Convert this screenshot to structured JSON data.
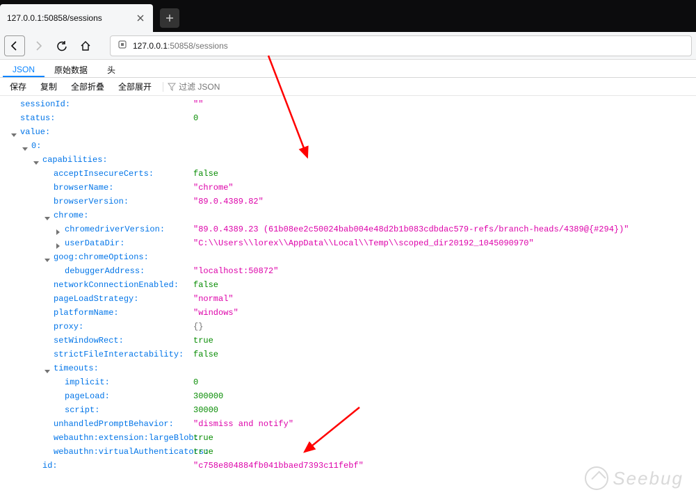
{
  "tab_title": "127.0.0.1:50858/sessions",
  "url": {
    "host": "127.0.0.1",
    "port": ":50858",
    "path": "/sessions"
  },
  "viewtabs": {
    "json": "JSON",
    "raw": "原始数据",
    "headers": "头"
  },
  "toolbar": {
    "save": "保存",
    "copy": "复制",
    "collapse": "全部折叠",
    "expand": "全部展开",
    "filter_placeholder": "过滤 JSON"
  },
  "json_rows": [
    {
      "indent": 0,
      "tw": "",
      "key": "sessionId",
      "vt": "str",
      "val": "\"\""
    },
    {
      "indent": 0,
      "tw": "",
      "key": "status",
      "vt": "num",
      "val": "0"
    },
    {
      "indent": 0,
      "tw": "open",
      "key": "value",
      "vt": "",
      "val": ""
    },
    {
      "indent": 1,
      "tw": "open",
      "key": "0",
      "vt": "",
      "val": ""
    },
    {
      "indent": 2,
      "tw": "open",
      "key": "capabilities",
      "vt": "",
      "val": ""
    },
    {
      "indent": 3,
      "tw": "",
      "key": "acceptInsecureCerts",
      "vt": "bool",
      "val": "false"
    },
    {
      "indent": 3,
      "tw": "",
      "key": "browserName",
      "vt": "str",
      "val": "\"chrome\""
    },
    {
      "indent": 3,
      "tw": "",
      "key": "browserVersion",
      "vt": "str",
      "val": "\"89.0.4389.82\""
    },
    {
      "indent": 3,
      "tw": "open",
      "key": "chrome",
      "vt": "",
      "val": ""
    },
    {
      "indent": 4,
      "tw": "closed",
      "key": "chromedriverVersion",
      "vt": "str",
      "val": "\"89.0.4389.23 (61b08ee2c50024bab004e48d2b1b083cdbdac579-refs/branch-heads/4389@{#294})\""
    },
    {
      "indent": 4,
      "tw": "closed",
      "key": "userDataDir",
      "vt": "str",
      "val": "\"C:\\\\Users\\\\lorex\\\\AppData\\\\Local\\\\Temp\\\\scoped_dir20192_1045090970\""
    },
    {
      "indent": 3,
      "tw": "open",
      "key": "goog:chromeOptions",
      "vt": "",
      "val": ""
    },
    {
      "indent": 4,
      "tw": "",
      "key": "debuggerAddress",
      "vt": "str",
      "val": "\"localhost:50872\""
    },
    {
      "indent": 3,
      "tw": "",
      "key": "networkConnectionEnabled",
      "vt": "bool",
      "val": "false"
    },
    {
      "indent": 3,
      "tw": "",
      "key": "pageLoadStrategy",
      "vt": "str",
      "val": "\"normal\""
    },
    {
      "indent": 3,
      "tw": "",
      "key": "platformName",
      "vt": "str",
      "val": "\"windows\""
    },
    {
      "indent": 3,
      "tw": "",
      "key": "proxy",
      "vt": "obj",
      "val": "{}"
    },
    {
      "indent": 3,
      "tw": "",
      "key": "setWindowRect",
      "vt": "bool",
      "val": "true"
    },
    {
      "indent": 3,
      "tw": "",
      "key": "strictFileInteractability",
      "vt": "bool",
      "val": "false"
    },
    {
      "indent": 3,
      "tw": "open",
      "key": "timeouts",
      "vt": "",
      "val": ""
    },
    {
      "indent": 4,
      "tw": "",
      "key": "implicit",
      "vt": "num",
      "val": "0"
    },
    {
      "indent": 4,
      "tw": "",
      "key": "pageLoad",
      "vt": "num",
      "val": "300000"
    },
    {
      "indent": 4,
      "tw": "",
      "key": "script",
      "vt": "num",
      "val": "30000"
    },
    {
      "indent": 3,
      "tw": "",
      "key": "unhandledPromptBehavior",
      "vt": "str",
      "val": "\"dismiss and notify\""
    },
    {
      "indent": 3,
      "tw": "",
      "key": "webauthn:extension:largeBlob",
      "vt": "bool",
      "val": "true"
    },
    {
      "indent": 3,
      "tw": "",
      "key": "webauthn:virtualAuthenticators",
      "vt": "bool",
      "val": "true"
    },
    {
      "indent": 2,
      "tw": "",
      "key": "id",
      "vt": "str",
      "val": "\"c758e804884fb041bbaed7393c11febf\""
    }
  ],
  "watermark": "Seebug"
}
